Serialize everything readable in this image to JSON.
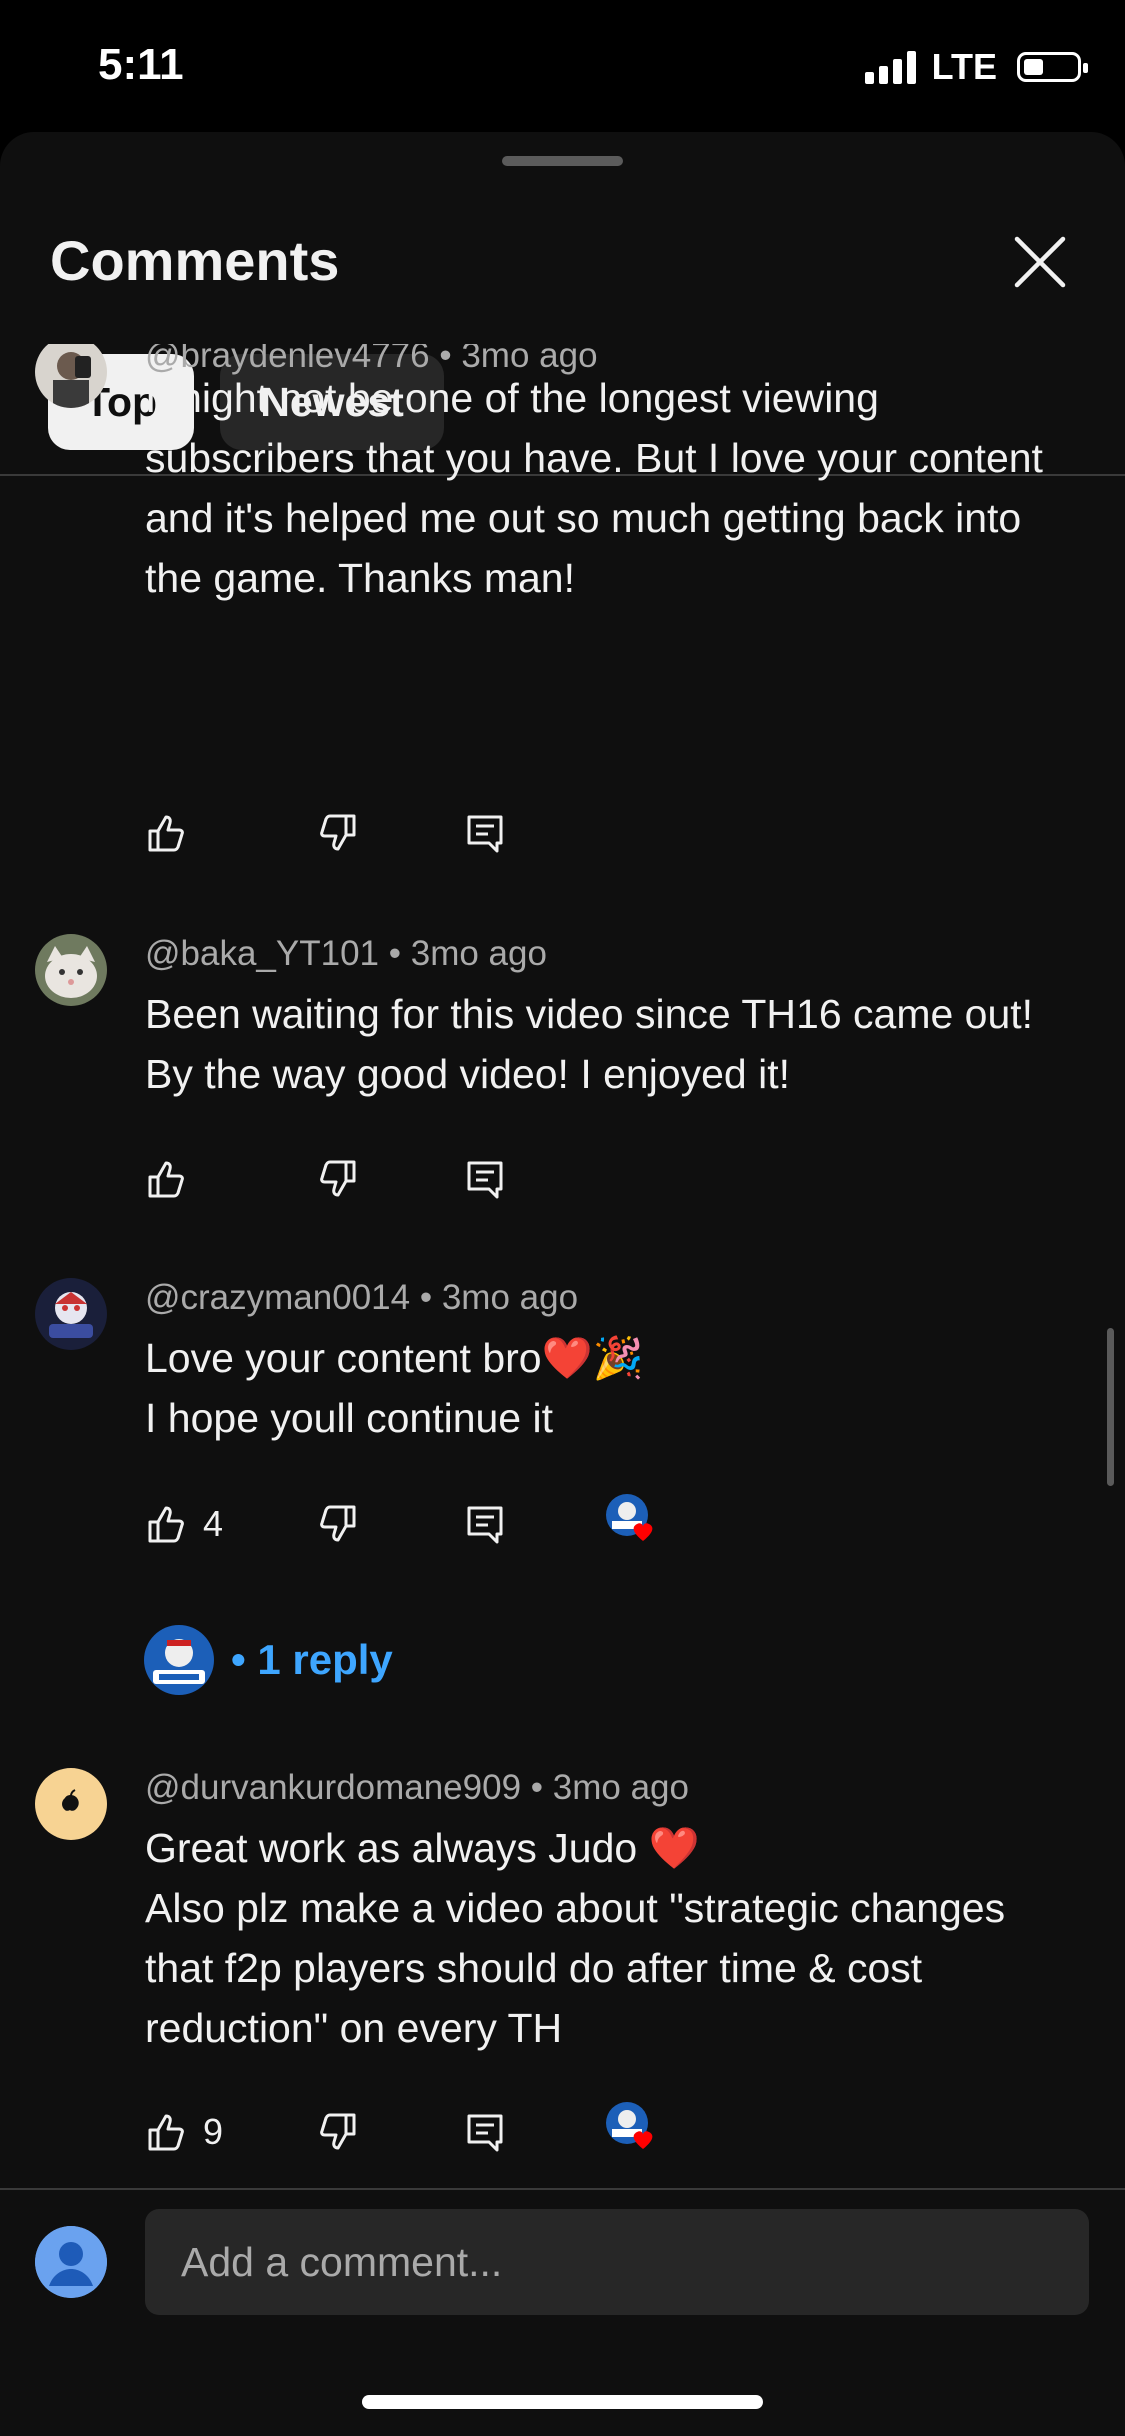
{
  "status_bar": {
    "time": "5:11",
    "network": "LTE"
  },
  "sheet": {
    "title": "Comments",
    "tabs": [
      {
        "label": "Top",
        "selected": true
      },
      {
        "label": "Newest",
        "selected": false
      }
    ]
  },
  "comments": [
    {
      "author": "@braydenlev4776",
      "age": "3mo ago",
      "text": "I might not be one of the longest viewing subscribers that you have. But I love your content and it's helped me out so much getting back into the game. Thanks man!",
      "likes": "",
      "hearted": false,
      "reply_count": ""
    },
    {
      "author": "@baka_YT101",
      "age": "3mo ago",
      "text": "Been waiting for this video since TH16 came out! By the way good video! I enjoyed it!",
      "likes": "",
      "hearted": false,
      "reply_count": ""
    },
    {
      "author": "@crazyman0014",
      "age": "3mo ago",
      "text_line1": "Love your content bro❤️🎉",
      "text_line2": "I hope youll continue it",
      "likes": "4",
      "hearted": true,
      "reply_count": "1 reply"
    },
    {
      "author": "@durvankurdomane909",
      "age": "3mo ago",
      "text_line1": "Great work as always Judo ❤️",
      "text_line2": "Also plz make a video about \"strategic changes that f2p players should do after time & cost reduction\" on every TH",
      "likes": "9",
      "hearted": true,
      "reply_count": ""
    }
  ],
  "footer": {
    "add_comment_placeholder": "Add a comment..."
  },
  "colors": {
    "background": "#0f0f0f",
    "link": "#3ea6ff",
    "chip_active": "#f1f1f1",
    "chip_inactive": "#272727"
  }
}
